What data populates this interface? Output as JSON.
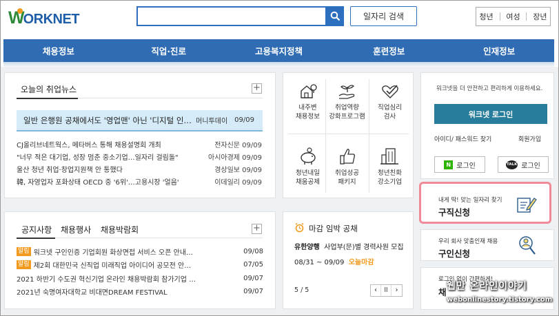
{
  "header": {
    "logo_w": "W",
    "logo_rest": "ORKNET",
    "job_search_label": "일자리 검색",
    "user_tabs": [
      "청년",
      "여성",
      "장년"
    ]
  },
  "nav": [
    "채용정보",
    "직업·진로",
    "고용복지정책",
    "훈련정보",
    "인재정보"
  ],
  "news": {
    "title": "오늘의 취업뉴스",
    "headline": {
      "text": "일반 은행원 공채에서도 '영업맨' 아닌 '디지털 인…",
      "source": "머니투데이",
      "date": "09/09"
    },
    "items": [
      {
        "text": "CJ올리브네트웍스, 메타버스 통해 채용설명회 개최",
        "source": "전자신문",
        "date": "09/09"
      },
      {
        "text": "\"너무 적은 대기업, 성장 멈춘 중소기업…일자리 걸림돌\"",
        "source": "아시아경제",
        "date": "09/09"
      },
      {
        "text": "울산 청년 취업·창업지원책 안 통했다",
        "source": "경상일보",
        "date": "09/09"
      },
      {
        "text": "韓, 자영업자 포화상태 OECD 중 '6위'…고용시장 '얼음'",
        "source": "이데일리",
        "date": "09/09"
      }
    ]
  },
  "notice": {
    "tabs": [
      "공지사항",
      "채용행사",
      "채용박람회"
    ],
    "items": [
      {
        "badge": "알림",
        "text": "워크넷 구인인증 기업회원 화상면접 서비스 오픈 안내…",
        "date": "09/08"
      },
      {
        "badge": "알림",
        "text": "제2회 대한민국 신직업 미래직업 아이디어 공모전 안…",
        "date": "07/05"
      },
      {
        "badge": "",
        "text": "2021 하반기 수도권 혁신기업 온라인 채용박람회 참가기업 …",
        "date": "09/07"
      },
      {
        "badge": "",
        "text": "2021년 숙명여자대학교 비대면DREAM FESTIVAL",
        "date": "09/07"
      }
    ]
  },
  "services": [
    {
      "line1": "내주변",
      "line2": "채용정보",
      "icon": "map-house-icon"
    },
    {
      "line1": "취업역량",
      "line2": "강화프로그램",
      "icon": "sprout-hand-icon"
    },
    {
      "line1": "직업심리",
      "line2": "검사",
      "icon": "heart-check-icon"
    },
    {
      "line1": "청년내일",
      "line2": "채움공제",
      "icon": "piggy-bank-icon"
    },
    {
      "line1": "취업성공",
      "line2": "패키지",
      "icon": "thumbs-up-icon"
    },
    {
      "line1": "청년친화",
      "line2": "강소기업",
      "icon": "building-icon"
    }
  ],
  "deadline": {
    "title": "마감 임박 공채",
    "company": "유한양행",
    "desc": "사업부(문)별 경력사원 모집",
    "period": "08/31 ~ 09/09",
    "status": "오늘마감",
    "page": "5 / 5",
    "accent": "#f29a1e"
  },
  "login": {
    "intro": "워크넷을 더 안전하고 편리하게 이용하세요.",
    "button": "워크넷 로그인",
    "find": "아이디/ 패스워드 찾기",
    "join": "회원가입",
    "naver": "로그인",
    "kakao": "로그인",
    "naver_icon": "N",
    "kakao_icon": "TALK"
  },
  "job_apply": {
    "sub": "내게 딱! 맞는 일자리 찾기",
    "title": "구직신청"
  },
  "recruit": {
    "sub": "우리 회사 맞춤인재 채용",
    "title": "구인신청"
  },
  "bottom_card": {
    "sub": "로그인 없이 간편하게!",
    "title": "채"
  },
  "watermark": {
    "line1": "웹만 온라인이야기",
    "line2": "webonlinestory.tistory.com"
  },
  "colors": {
    "nav": "#2f6cb3",
    "login": "#277d9b",
    "highlight": "#f08a97",
    "badge": "#f29a1e"
  }
}
